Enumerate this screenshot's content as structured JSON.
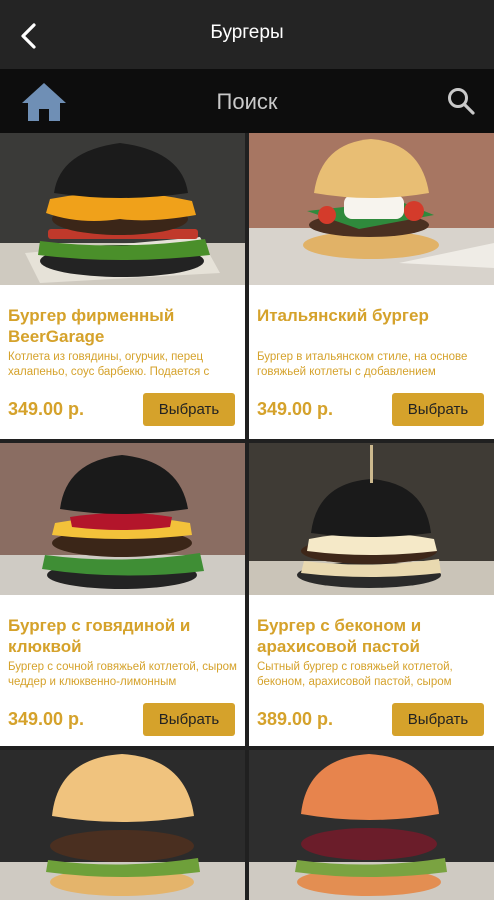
{
  "header": {
    "title": "Бургеры"
  },
  "searchbar": {
    "label": "Поиск"
  },
  "products": [
    {
      "name": "Бургер фирменный BeerGarage",
      "description": "Котлета из говядины, огурчик, перец халапеньо, соус барбекю. Подается с",
      "price": "349.00 р.",
      "button": "Выбрать"
    },
    {
      "name": "Итальянский бургер",
      "description": "Бургер в итальянском стиле, на основе говяжьей котлеты с добавлением",
      "price": "349.00 р.",
      "button": "Выбрать"
    },
    {
      "name": "Бургер с говядиной и клюквой",
      "description": "Бургер с сочной говяжьей котлетой, сыром чеддер и клюквенно-лимонным",
      "price": "349.00 р.",
      "button": "Выбрать"
    },
    {
      "name": "Бургер с беконом и арахисовой пастой",
      "description": "Сытный бургер с говяжьей котлетой, беконом, арахисовой пастой, сыром",
      "price": "389.00 р.",
      "button": "Выбрать"
    }
  ],
  "icons": {
    "back": "back-arrow-icon",
    "home": "home-icon",
    "search": "search-icon"
  },
  "colors": {
    "accent": "#d5a22b",
    "topbar": "#242424",
    "searchbar": "#0d0d0d"
  }
}
